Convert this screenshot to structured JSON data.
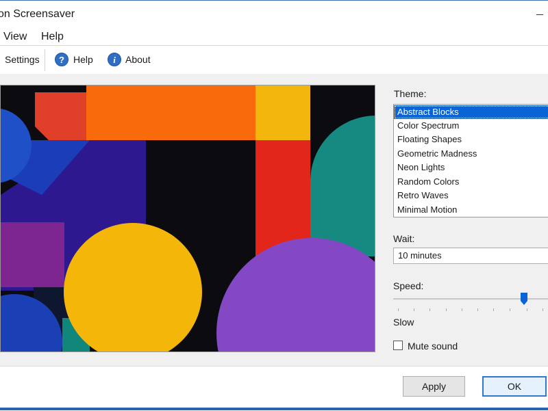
{
  "window": {
    "title": "on Screensaver"
  },
  "menu": {
    "items": [
      "View",
      "Help"
    ]
  },
  "toolbar": {
    "settings_label": "Settings",
    "help_label": "Help",
    "about_label": "About",
    "help_icon_glyph": "?",
    "about_icon_glyph": "i"
  },
  "theme": {
    "label": "Theme:",
    "options": [
      "Abstract Blocks",
      "Color Spectrum",
      "Floating Shapes",
      "Geometric Madness",
      "Neon Lights",
      "Random Colors",
      "Retro Waves",
      "Minimal Motion"
    ],
    "selected": "Abstract Blocks"
  },
  "wait": {
    "label": "Wait:",
    "value": "10 minutes"
  },
  "speed": {
    "label": "Speed:",
    "min_label": "Slow",
    "level": 0.85
  },
  "mute": {
    "label": "Mute sound",
    "checked": false
  },
  "buttons": {
    "apply": "Apply",
    "ok": "OK"
  },
  "colors": {
    "accent": "#0a64d6",
    "selection": "#0a64d6",
    "ok_border": "#2f77d0"
  }
}
